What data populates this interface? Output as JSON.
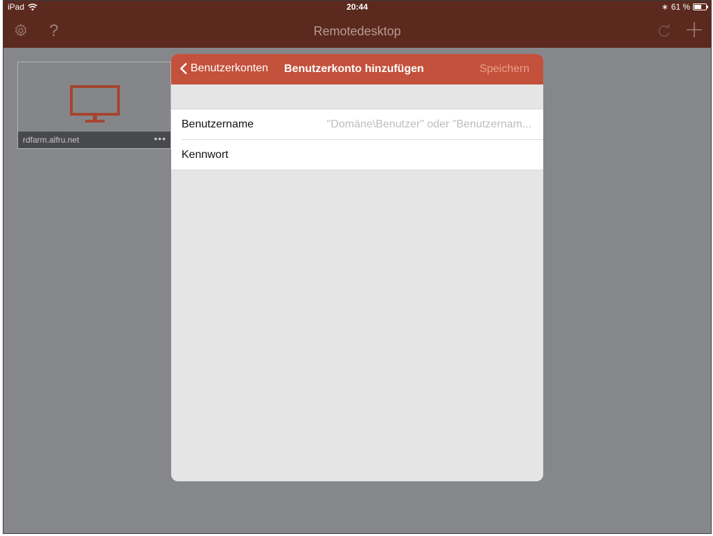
{
  "status_bar": {
    "device": "iPad",
    "time": "20:44",
    "bluetooth": "∗",
    "battery_text": "61 %"
  },
  "navbar": {
    "title": "Remotedesktop",
    "icons": [
      "gear-icon",
      "help-icon",
      "refresh-icon",
      "add-icon"
    ]
  },
  "connection_tile": {
    "name": "rdfarm.alfru.net",
    "more": "•••"
  },
  "modal": {
    "back_label": "Benutzerkonten",
    "title": "Benutzerkonto hinzufügen",
    "save_label": "Speichern",
    "fields": [
      {
        "label": "Benutzername",
        "placeholder": "\"Domäne\\Benutzer\" oder \"Benutzernam...",
        "value": ""
      },
      {
        "label": "Kennwort",
        "placeholder": "",
        "value": ""
      }
    ]
  },
  "colors": {
    "bar_bg": "#5b291e",
    "modal_header": "#c4513b",
    "monitor_icon": "#a54530"
  }
}
